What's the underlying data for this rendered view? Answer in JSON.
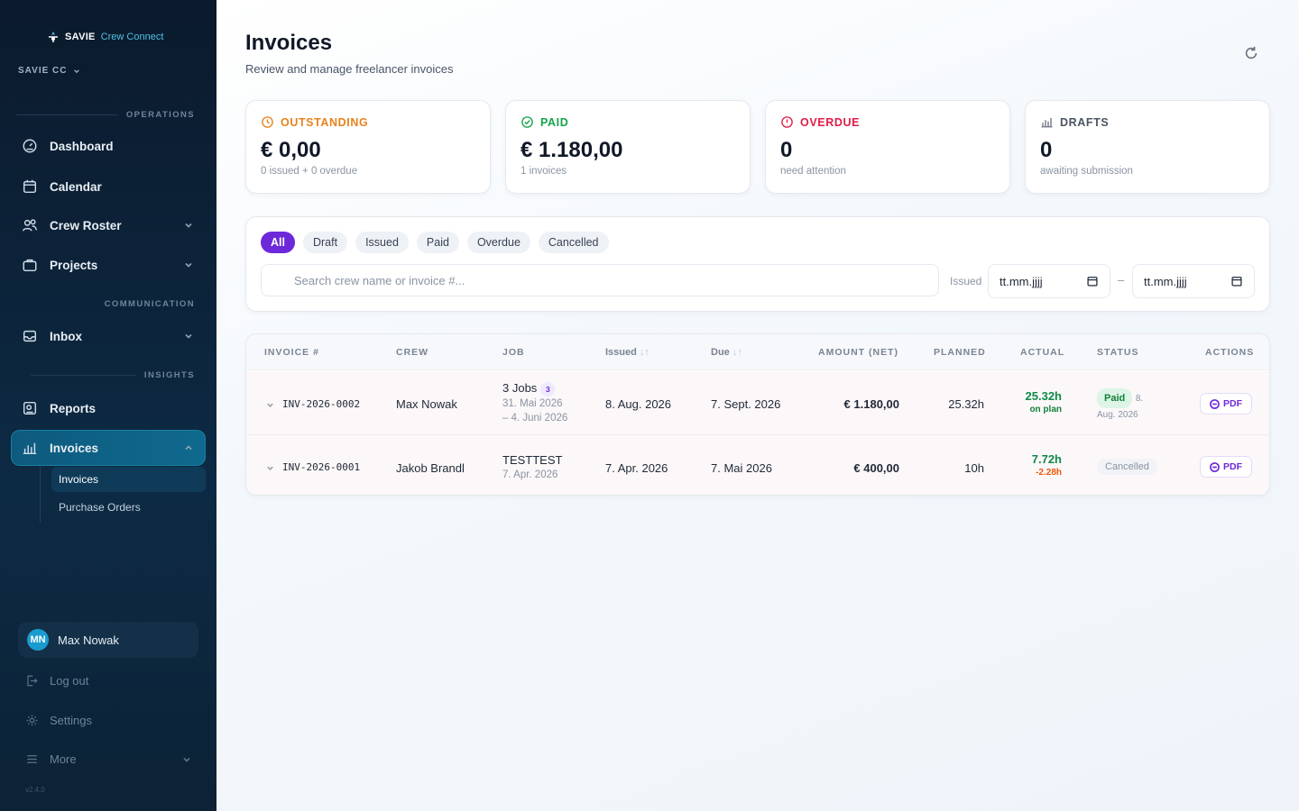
{
  "sidebar": {
    "brand_name": "SAVIE",
    "brand_product": "Crew Connect",
    "org": "SAVIE CC",
    "sections": {
      "operations": "OPERATIONS",
      "communication": "COMMUNICATION",
      "insights": "INSIGHTS"
    },
    "items": {
      "dashboard": "Dashboard",
      "calendar": "Calendar",
      "crew_roster": "Crew Roster",
      "projects": "Projects",
      "inbox": "Inbox",
      "reports": "Reports",
      "invoices": "Invoices"
    },
    "subitems": {
      "invoices": "Invoices",
      "purchase_orders": "Purchase Orders"
    },
    "user": {
      "initials": "MN",
      "name": "Max Nowak"
    },
    "logout": "Log out",
    "settings": "Settings",
    "more": "More",
    "version": "v2.4.0"
  },
  "header": {
    "title": "Invoices",
    "subtitle": "Review and manage freelancer invoices"
  },
  "stats": {
    "outstanding": {
      "label": "OUTSTANDING",
      "value": "€ 0,00",
      "note": "0 issued + 0 overdue",
      "color": "#e8821c"
    },
    "paid": {
      "label": "PAID",
      "value": "€ 1.180,00",
      "note": "1 invoices",
      "color": "#16a34a"
    },
    "overdue": {
      "label": "OVERDUE",
      "value": "0",
      "note": "need attention",
      "color": "#e11d48"
    },
    "drafts": {
      "label": "DRAFTS",
      "value": "0",
      "note": "awaiting submission",
      "color": "#6b7280"
    }
  },
  "filters": {
    "chips": [
      "All",
      "Draft",
      "Issued",
      "Paid",
      "Overdue",
      "Cancelled"
    ],
    "search_placeholder": "Search crew name or invoice #...",
    "issued_label": "Issued",
    "date_from": "tt.mm.jjjj",
    "date_to": "tt.mm.jjjj",
    "separator": "–"
  },
  "table": {
    "columns": {
      "invoice": "INVOICE #",
      "crew": "CREW",
      "job": "JOB",
      "issued": "Issued",
      "due": "Due",
      "amount": "AMOUNT (NET)",
      "planned": "PLANNED",
      "actual": "ACTUAL",
      "status": "STATUS",
      "actions": "ACTIONS"
    },
    "rows": [
      {
        "invoice": "INV-2026-0002",
        "crew": "Max Nowak",
        "job": "3 Jobs",
        "job_count": "3",
        "job_dates_1": "31. Mai 2026",
        "job_dates_2": "– 4. Juni 2026",
        "issued": "8. Aug. 2026",
        "due": "7. Sept. 2026",
        "amount": "€ 1.180,00",
        "planned": "25.32h",
        "actual": "25.32h",
        "actual_note": "on plan",
        "status": "Paid",
        "status_date_1": "8.",
        "status_date_2": "Aug. 2026",
        "action": "PDF"
      },
      {
        "invoice": "INV-2026-0001",
        "crew": "Jakob Brandl",
        "job": "TESTTEST",
        "job_dates_1": "7. Apr. 2026",
        "issued": "7. Apr. 2026",
        "due": "7. Mai 2026",
        "amount": "€ 400,00",
        "planned": "10h",
        "actual": "7.72h",
        "actual_note": "-2.28h",
        "status": "Cancelled",
        "action": "PDF"
      }
    ]
  },
  "colors": {
    "accent": "#6d28d9",
    "sidebar_bg": "#0b1a2c",
    "active_nav": "#0f6a8e"
  }
}
